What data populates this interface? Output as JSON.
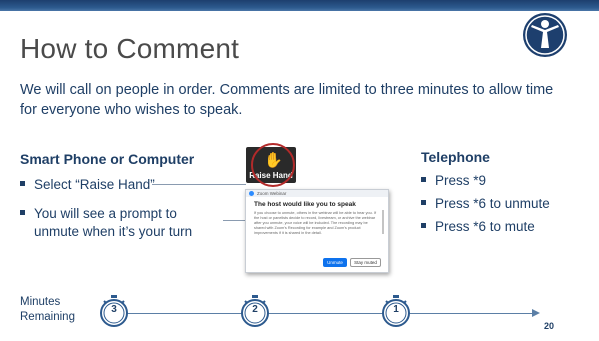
{
  "slide": {
    "title": "How to Comment",
    "intro": "We will call on people in order. Comments are limited to three minutes to allow time for everyone who wishes to speak.",
    "page_number": "20",
    "logo": {
      "icon": "person-logo-icon",
      "color": "#1d3f6e"
    }
  },
  "phone_section": {
    "heading": "Smart Phone or Computer",
    "bullets": [
      "Select “Raise Hand”",
      "You will see a prompt to",
      "unmute when it’s your turn"
    ]
  },
  "telephone_section": {
    "heading": "Telephone",
    "bullets": [
      "Press *9",
      "Press *6 to unmute",
      "Press *6 to mute"
    ]
  },
  "raise_hand_button": {
    "icon": "raised-hand-icon",
    "label": "Raise Hand",
    "highlight_color": "#b22a2a"
  },
  "unmute_dialog": {
    "app_name": "Zoom Webinar",
    "title": "The host would like you to speak",
    "body": "If you choose to unmute, others in the webinar will be able to hear you. If the host or panelists decide to record, livestream, or archive the webinar after you unmute, your voice will be included. The recording may be shared with Zoom's Recording for example and Zoom's product improvements if it is shared in the detail.",
    "unmute_label": "Unmute",
    "stay_muted_label": "Stay muted"
  },
  "timeline": {
    "label_line1": "Minutes",
    "label_line2": "Remaining",
    "timers": [
      "3",
      "2",
      "1"
    ],
    "icon": "stopwatch-icon"
  },
  "colors": {
    "accent": "#1f3f66",
    "header_bar": "#1d3f6e",
    "ring": "#b22a2a",
    "zoom_blue": "#0e72ed"
  }
}
